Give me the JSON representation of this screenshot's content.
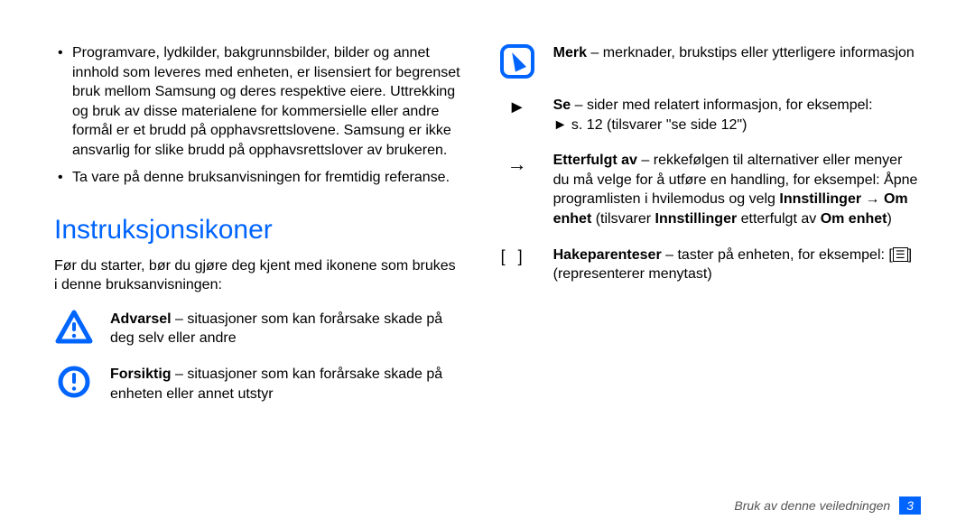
{
  "left": {
    "bullets": [
      "Programvare, lydkilder, bakgrunnsbilder, bilder og annet innhold som leveres med enheten, er lisensiert for begrenset bruk mellom Samsung og deres respektive eiere. Uttrekking og bruk av disse materialene for kommersielle eller andre formål er et brudd på opphavsrettslovene. Samsung er ikke ansvarlig for slike brudd på opphavsrettslover av brukeren.",
      "Ta vare på denne bruksanvisningen for fremtidig referanse."
    ],
    "heading": "Instruksjonsikoner",
    "intro": "Før du starter, bør du gjøre deg kjent med ikonene som brukes i denne bruksanvisningen:",
    "warning": {
      "label": "Advarsel",
      "text": " – situasjoner som kan forårsake skade på deg selv eller andre"
    },
    "caution": {
      "label": "Forsiktig",
      "text": " – situasjoner som kan forårsake skade på enheten eller annet utstyr"
    }
  },
  "right": {
    "note": {
      "label": "Merk",
      "text": " – merknader, brukstips eller ytterligere informasjon"
    },
    "see": {
      "symbol": "►",
      "label": "Se",
      "text1": " – sider med relatert informasjon, for eksempel: ",
      "arrow": "►",
      "text2": " s. 12 (tilsvarer \"se side 12\")"
    },
    "followed": {
      "symbol": "→",
      "label": "Etterfulgt av",
      "text1": " – rekkefølgen til alternativer eller menyer du må velge for å utføre en handling, for eksempel: Åpne programlisten i hvilemodus og velg ",
      "bold1": "Innstillinger",
      "arrow2": " → ",
      "bold2": "Om enhet",
      "paren_open": " (tilsvarer ",
      "bold3": "Innstillinger",
      "mid": " etterfulgt av ",
      "bold4": "Om enhet",
      "paren_close": ")"
    },
    "brackets": {
      "left": "[",
      "right": "]",
      "label": "Hakeparenteser",
      "text1": " – taster på enheten, for eksempel: [",
      "menu_glyph": "☰",
      "text2": "] (representerer menytast)"
    }
  },
  "footer": {
    "text": "Bruk av denne veiledningen",
    "page": "3"
  }
}
